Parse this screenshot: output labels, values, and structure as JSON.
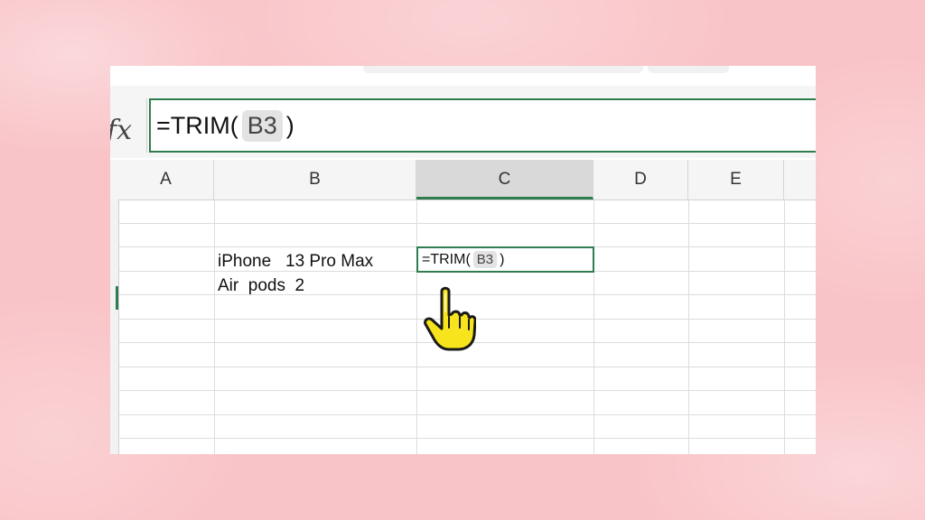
{
  "formula_bar": {
    "fx_label": "fx",
    "formula_prefix": "=TRIM(",
    "formula_ref": "B3",
    "formula_suffix": ")"
  },
  "columns": [
    {
      "label": "A",
      "selected": false
    },
    {
      "label": "B",
      "selected": false
    },
    {
      "label": "C",
      "selected": true
    },
    {
      "label": "D",
      "selected": false
    },
    {
      "label": "E",
      "selected": false
    }
  ],
  "cells": {
    "B3": "iPhone   13 Pro Max",
    "B4": "Air  pods  2",
    "C3": {
      "formula_prefix": "=TRIM(",
      "formula_ref": "B3",
      "formula_suffix": ")"
    }
  },
  "colors": {
    "accent": "#2f7d4f",
    "background": "#f9c4c8",
    "cursor": "#f7e41c"
  },
  "icons": {
    "cursor": "pointing-hand-icon",
    "fx": "fx-icon"
  }
}
